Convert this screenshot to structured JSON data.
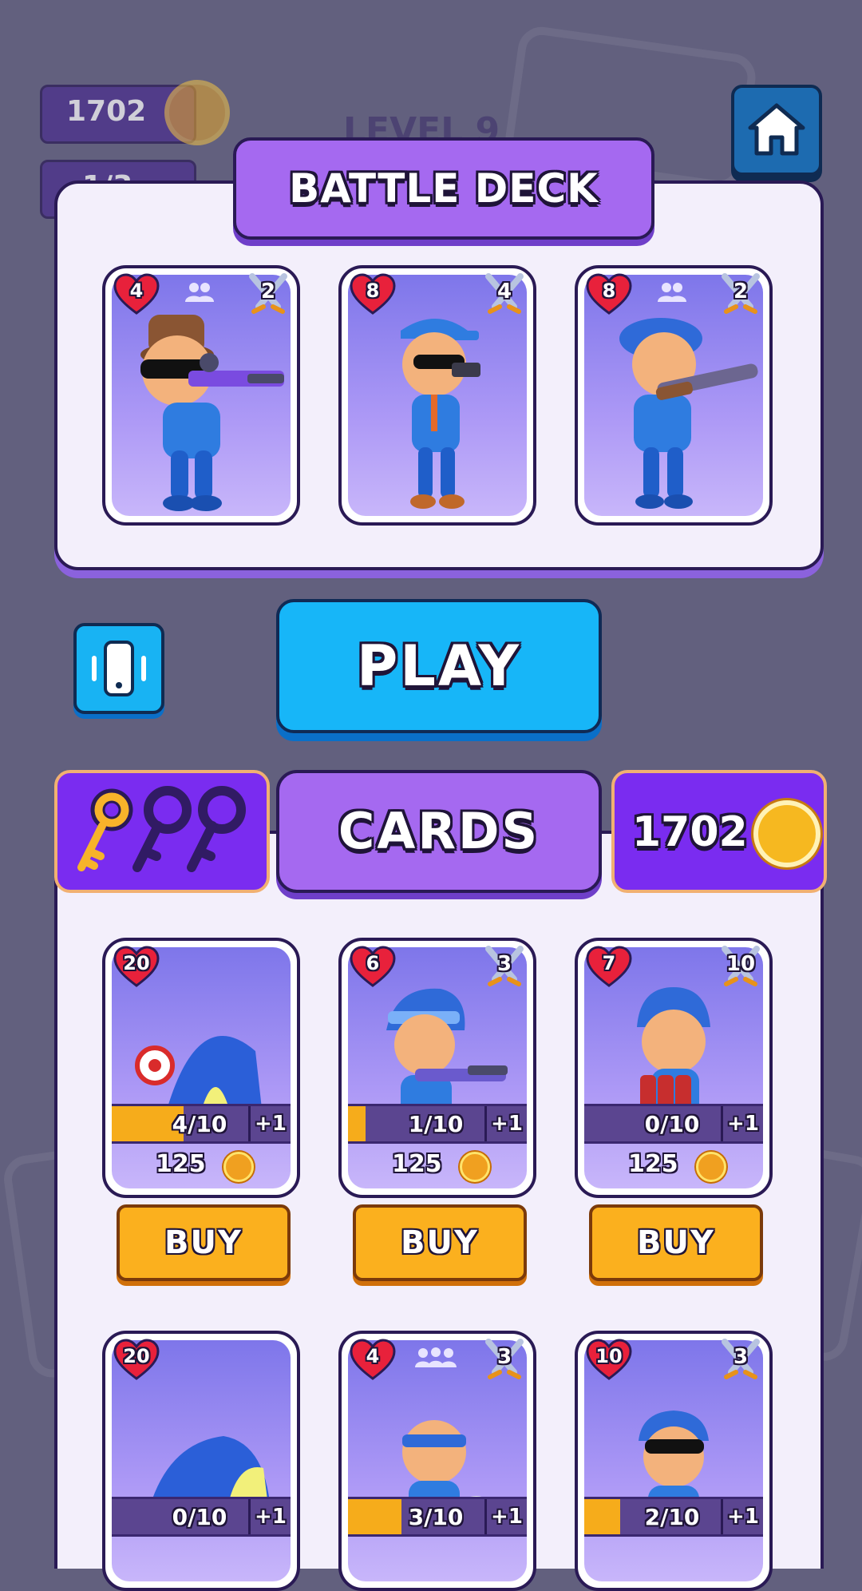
{
  "hud": {
    "coins": "1702",
    "keys": "1/3",
    "level": "LEVEL 9"
  },
  "battle_deck": {
    "title": "BATTLE DECK",
    "cards": [
      {
        "health": "4",
        "attack": "2",
        "team_icon": "group-icon",
        "character": "sniper"
      },
      {
        "health": "8",
        "attack": "4",
        "character": "pistol"
      },
      {
        "health": "8",
        "attack": "2",
        "team_icon": "group-icon",
        "character": "shotgun"
      }
    ]
  },
  "play_button": "PLAY",
  "cards_section": {
    "title": "CARDS",
    "coins": "1702",
    "keys_owned": 1,
    "keys_total": 3,
    "cards": [
      {
        "health": "20",
        "progress": "4/10",
        "progress_value": 0.4,
        "plus": "+1",
        "price": "125",
        "buy": "BUY",
        "character": "tent"
      },
      {
        "health": "6",
        "attack": "3",
        "progress": "1/10",
        "progress_value": 0.1,
        "plus": "+1",
        "price": "125",
        "buy": "BUY",
        "character": "rifle"
      },
      {
        "health": "7",
        "attack": "10",
        "progress": "0/10",
        "progress_value": 0.0,
        "plus": "+1",
        "price": "125",
        "buy": "BUY",
        "character": "bomber"
      },
      {
        "health": "20",
        "progress": "0/10",
        "progress_value": 0.0,
        "plus": "+1",
        "character": "bunker"
      },
      {
        "health": "4",
        "attack": "3",
        "team_icon": "crowd-icon",
        "progress": "3/10",
        "progress_value": 0.3,
        "plus": "+1",
        "character": "knife"
      },
      {
        "health": "10",
        "attack": "3",
        "progress": "2/10",
        "progress_value": 0.2,
        "plus": "+1",
        "character": "club"
      }
    ]
  },
  "colors": {
    "background": "#62607e",
    "panel": "#f3effb",
    "tab_purple": "#a569f0",
    "play_blue": "#17b6f8",
    "buy_orange": "#fbb01e",
    "heart_red": "#e8213b"
  }
}
